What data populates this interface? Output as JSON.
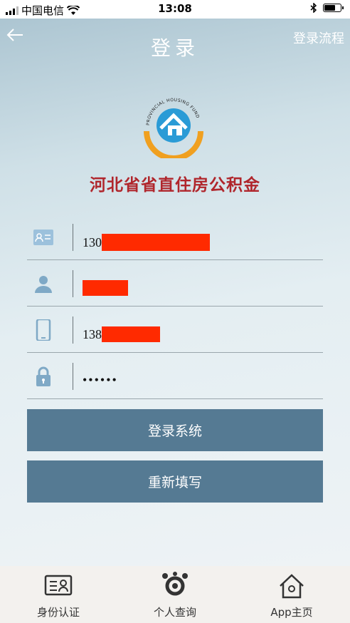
{
  "status_bar": {
    "carrier": "中国电信",
    "time": "13:08"
  },
  "nav": {
    "title": "登录",
    "right_link": "登录流程"
  },
  "org": {
    "name": "河北省省直住房公积金",
    "logo_text": "PROVINCIAL HOUSING FUND"
  },
  "form": {
    "id_number_prefix": "130",
    "name_value": "",
    "phone_prefix": "138",
    "password_masked": "••••••"
  },
  "buttons": {
    "login": "登录系统",
    "reset": "重新填写"
  },
  "tabs": [
    {
      "label": "身份认证",
      "icon": "id-card-icon"
    },
    {
      "label": "个人查询",
      "icon": "person-query-icon"
    },
    {
      "label": "App主页",
      "icon": "home-icon"
    }
  ],
  "colors": {
    "accent": "#557a93",
    "org_name": "#b0262c",
    "redaction": "#ff2a00"
  }
}
